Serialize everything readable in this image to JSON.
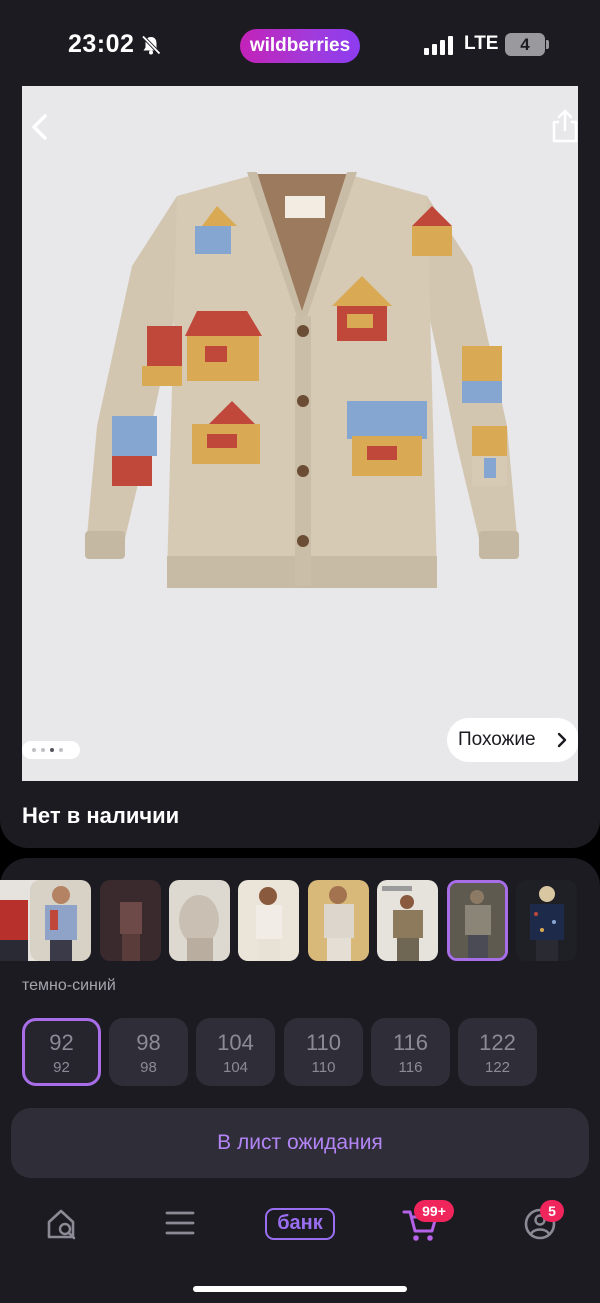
{
  "status_bar": {
    "time": "23:02",
    "app_logo": "wildberries",
    "network": "LTE",
    "battery": "4"
  },
  "product": {
    "similar_label": "Похожие",
    "availability": "Нет в наличии",
    "gallery_pages": 4,
    "gallery_active_page": 3
  },
  "options": {
    "color_name": "темно-синий",
    "selected_thumb_index": 7,
    "sizes": [
      {
        "size": "92",
        "ru": "92",
        "selected": true
      },
      {
        "size": "98",
        "ru": "98",
        "selected": false
      },
      {
        "size": "104",
        "ru": "104",
        "selected": false
      },
      {
        "size": "110",
        "ru": "110",
        "selected": false
      },
      {
        "size": "116",
        "ru": "116",
        "selected": false
      },
      {
        "size": "122",
        "ru": "122",
        "selected": false
      }
    ],
    "waitlist_label": "В лист ожидания"
  },
  "nav": {
    "bank_label": "банк",
    "cart_badge": "99+",
    "profile_badge": "5"
  },
  "colors": {
    "accent": "#a76ee7",
    "badge": "#f0255c",
    "surface": "#1c1b22",
    "chip": "#2f2e38"
  }
}
